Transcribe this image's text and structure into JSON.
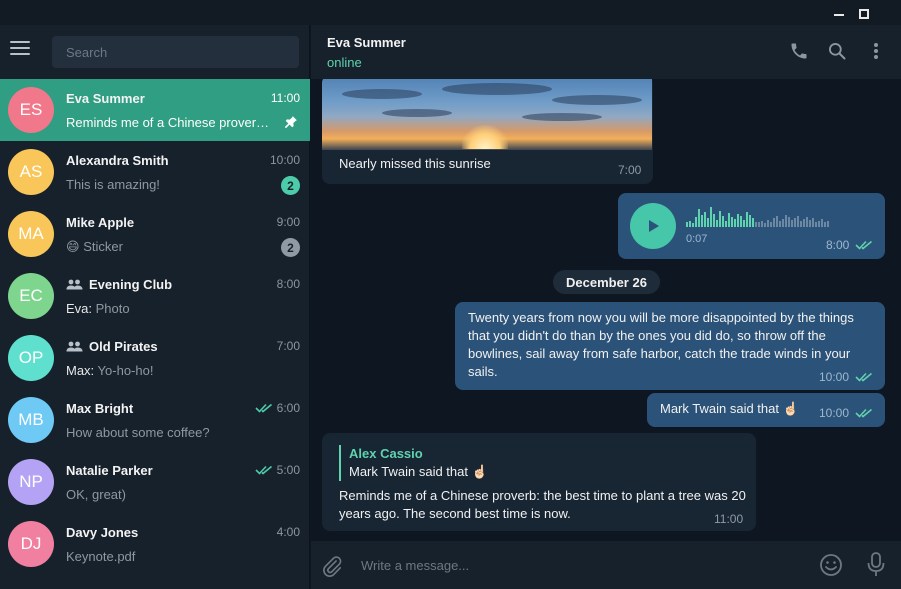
{
  "window": {
    "controls": [
      "minimize",
      "maximize"
    ]
  },
  "sidebar": {
    "menu_icon": "hamburger-menu-icon",
    "search_placeholder": "Search",
    "chats": [
      {
        "initials": "ES",
        "avatar_color": "#f0788a",
        "name": "Eva Summer",
        "time": "11:00",
        "preview": "Reminds me of a Chinese proverb: the best time to plant a tree was 20 years ago.",
        "pinned": true,
        "active": true
      },
      {
        "initials": "AS",
        "avatar_color": "#f8c659",
        "name": "Alexandra Smith",
        "time": "10:00",
        "preview": "This is amazing!",
        "unread": "2",
        "badge_color": "#4dcca9"
      },
      {
        "initials": "MA",
        "avatar_color": "#f8c659",
        "name": "Mike Apple",
        "time": "9:00",
        "preview_emoji": "😄",
        "preview": "Sticker",
        "unread": "2",
        "badge_color": "#8f9aa5"
      },
      {
        "initials": "EC",
        "avatar_color": "#7ed58e",
        "name": "Evening Club",
        "group": true,
        "time": "8:00",
        "sender": "Eva:",
        "preview": " Photo"
      },
      {
        "initials": "OP",
        "avatar_color": "#5fe0cf",
        "name": "Old Pirates",
        "group": true,
        "time": "7:00",
        "sender": "Max:",
        "preview": " Yo-ho-ho!"
      },
      {
        "initials": "MB",
        "avatar_color": "#6ec9f5",
        "name": "Max Bright",
        "time": "6:00",
        "read": true,
        "preview": "How about some coffee?"
      },
      {
        "initials": "NP",
        "avatar_color": "#b4a3f4",
        "name": "Natalie Parker",
        "time": "5:00",
        "read": true,
        "preview": "OK, great)"
      },
      {
        "initials": "DJ",
        "avatar_color": "#f07fa0",
        "name": "Davy Jones",
        "time": "4:00",
        "preview": "Keynote.pdf"
      }
    ]
  },
  "header": {
    "name": "Eva Summer",
    "status": "online",
    "icons": [
      "phone-icon",
      "search-icon",
      "more-vertical-icon"
    ]
  },
  "messages": {
    "photo_caption": "Nearly missed this sunrise",
    "photo_time": "7:00",
    "voice_duration": "0:07",
    "voice_time": "8:00",
    "date_divider": "December 26",
    "quote_text": "Twenty years from now you will be more disappointed by the things that you didn't do than by the ones you did do, so throw off the bowlines, sail away from safe harbor, catch the trade winds in your sails.",
    "quote_time": "10:00",
    "twain_text": "Mark Twain said that",
    "twain_emoji": "☝🏻",
    "twain_time": "10:00",
    "reply_author": "Alex Cassio",
    "reply_quote": "Mark Twain said that",
    "reply_emoji": "☝🏻",
    "reply_text": "Reminds me of a Chinese proverb: the best time to plant a tree was 20 years ago. The second best time is now.",
    "reply_time": "11:00"
  },
  "composer": {
    "placeholder": "Write a message...",
    "icons": [
      "paperclip-icon",
      "emoji-icon",
      "microphone-icon"
    ]
  },
  "colors": {
    "accent": "#5fd2ae",
    "active_chat": "#2f9e83",
    "incoming_bubble": "#182533",
    "outgoing_bubble": "#2b5278"
  }
}
